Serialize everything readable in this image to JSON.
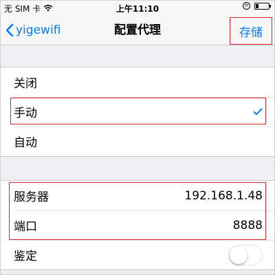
{
  "status_bar": {
    "carrier": "无 SIM 卡",
    "time": "上午11:10"
  },
  "nav": {
    "back_label": "yigewifi",
    "title": "配置代理",
    "save_label": "存储"
  },
  "proxy_modes": [
    {
      "label": "关闭",
      "selected": false
    },
    {
      "label": "手动",
      "selected": true
    },
    {
      "label": "自动",
      "selected": false
    }
  ],
  "manual": {
    "server_label": "服务器",
    "server_value": "192.168.1.48",
    "port_label": "端口",
    "port_value": "8888",
    "auth_label": "鉴定",
    "auth_enabled": false
  },
  "colors": {
    "accent": "#007aff",
    "highlight": "#e02020"
  }
}
